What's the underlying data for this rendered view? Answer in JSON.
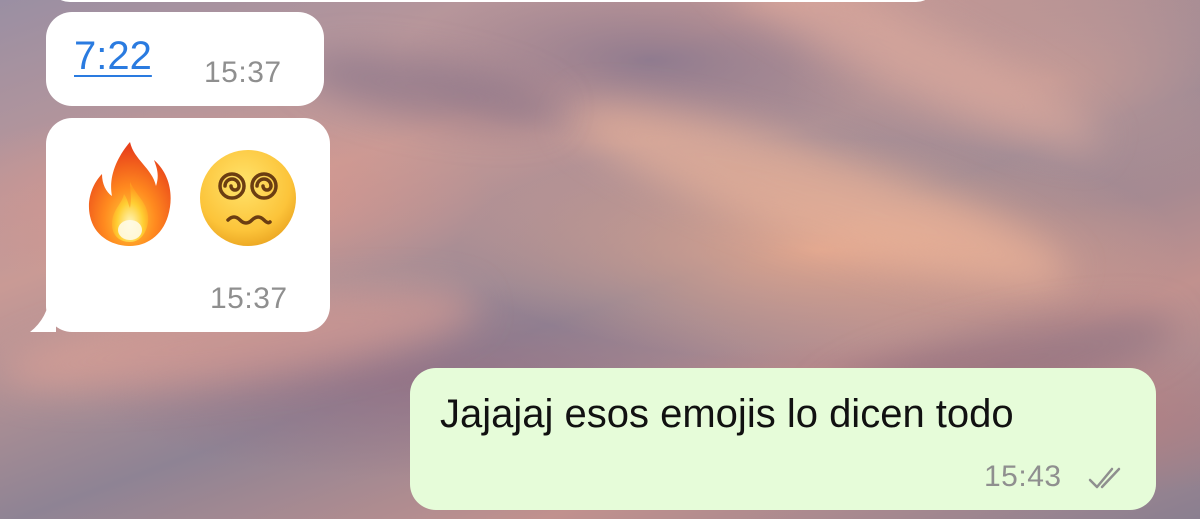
{
  "conversation": {
    "messages": [
      {
        "direction": "incoming",
        "link_text": "7:22",
        "time": "15:37"
      },
      {
        "direction": "incoming",
        "emojis": [
          "fire-emoji",
          "dizzy-face-emoji"
        ],
        "time": "15:37"
      },
      {
        "direction": "outgoing",
        "text": "Jajajaj esos emojis lo dicen todo",
        "time": "15:43",
        "status_icon": "double-check-read-icon"
      }
    ]
  },
  "colors": {
    "incoming_bubble": "#ffffff",
    "outgoing_bubble": "#e6fcd9",
    "link": "#2a7be0",
    "timestamp": "#8f8f8f"
  }
}
